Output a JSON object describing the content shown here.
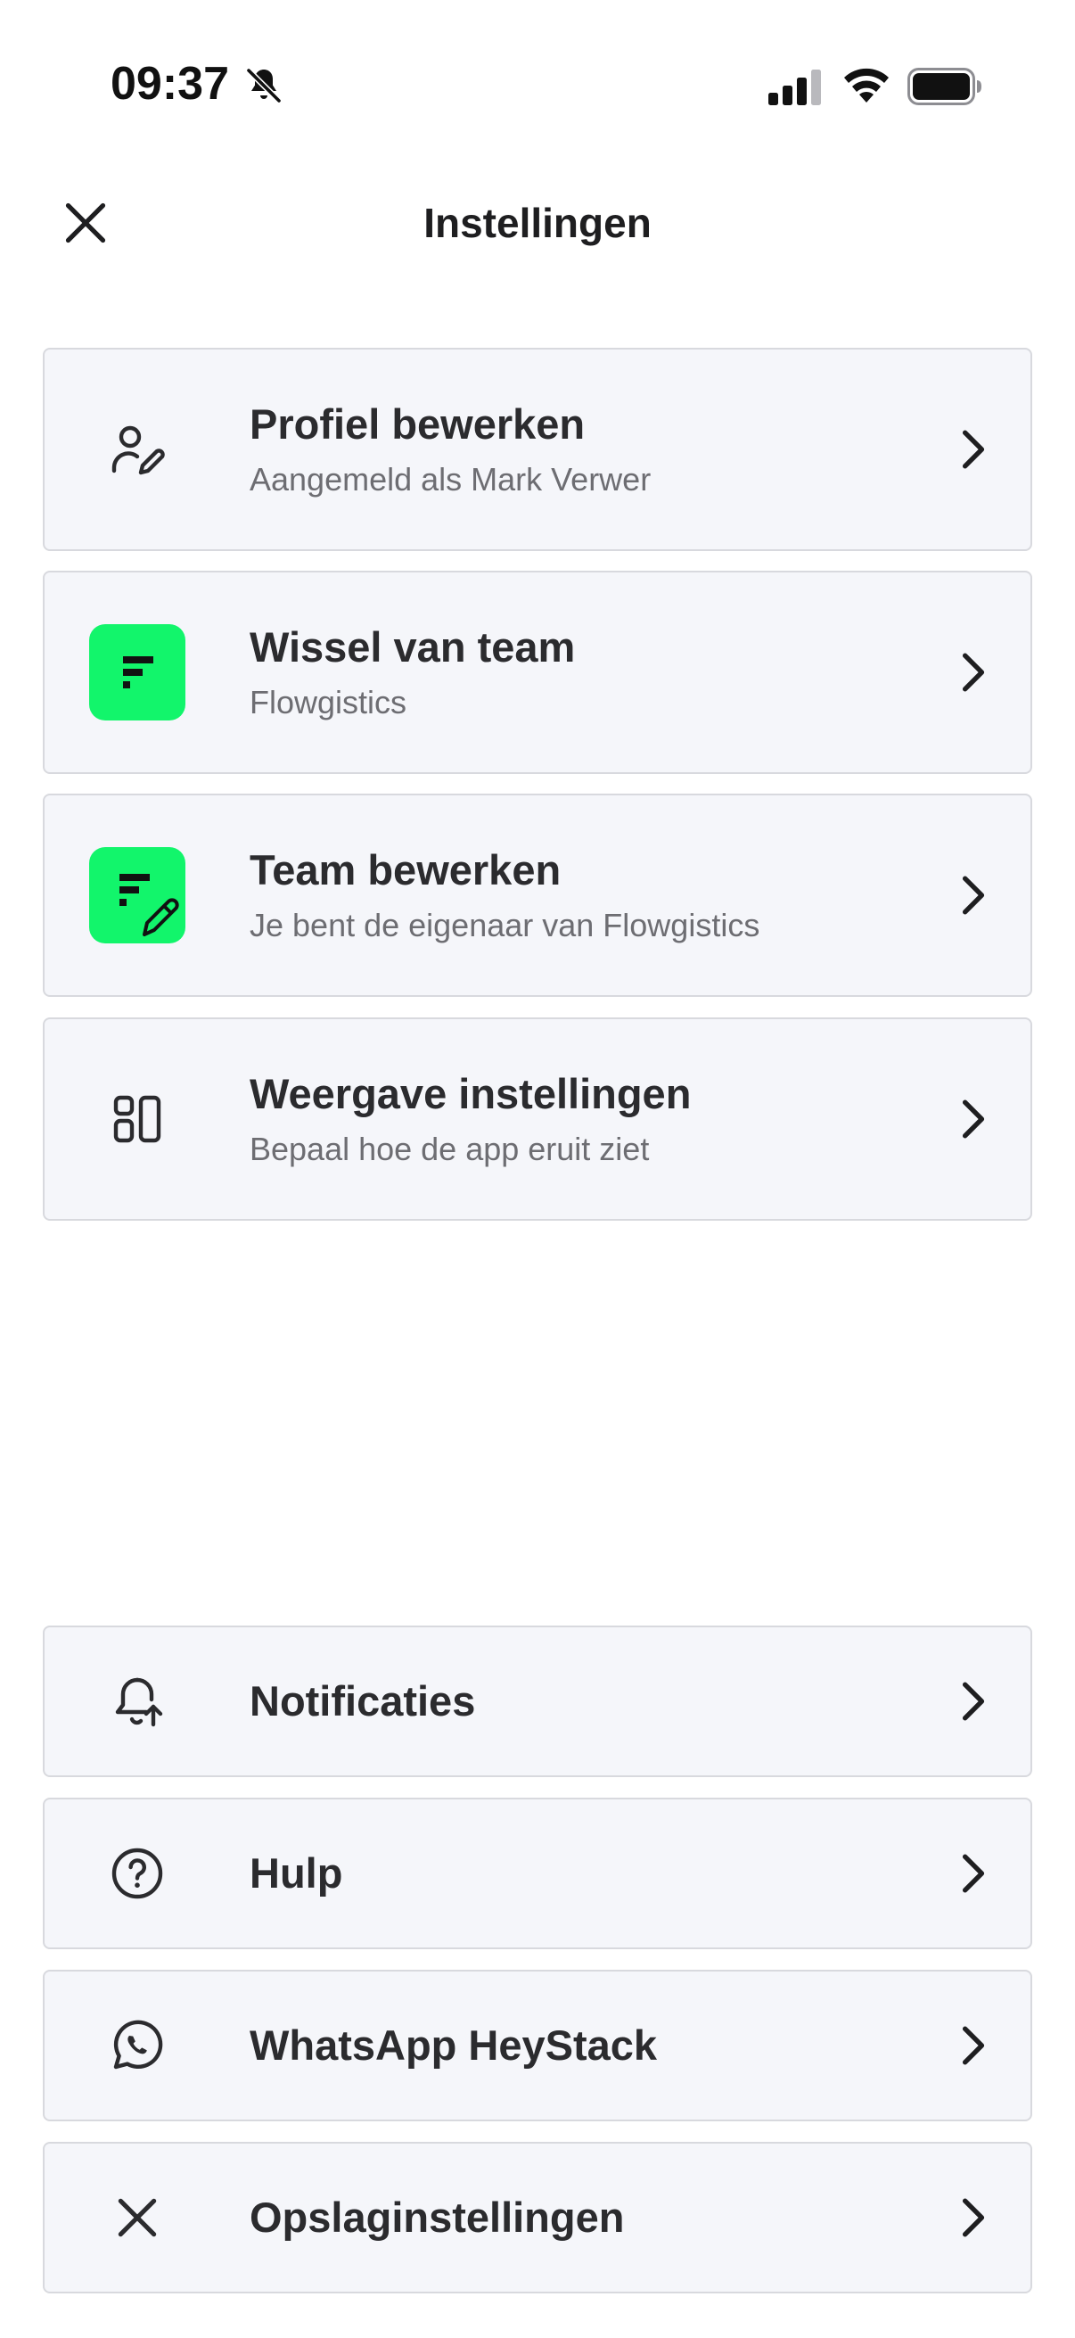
{
  "status_bar": {
    "time": "09:37",
    "icons": [
      "bell-slash-icon",
      "cellular-signal-icon",
      "wifi-icon",
      "battery-icon"
    ]
  },
  "header": {
    "title": "Instellingen",
    "close_icon": "close-icon"
  },
  "colors": {
    "brand_green": "#12f56b",
    "card_bg": "#f5f6fa",
    "card_border": "#d8d9de",
    "title_text": "#2b2b2e",
    "subtitle_text": "#6d6d72"
  },
  "top_items": [
    {
      "title": "Profiel bewerken",
      "subtitle": "Aangemeld als Mark Verwer",
      "icon": "user-edit-icon"
    },
    {
      "title": "Wissel van team",
      "subtitle": "Flowgistics",
      "icon": "team-logo-icon"
    },
    {
      "title": "Team bewerken",
      "subtitle": "Je bent de eigenaar van Flowgistics",
      "icon": "team-edit-icon"
    },
    {
      "title": "Weergave instellingen",
      "subtitle": "Bepaal hoe de app eruit ziet",
      "icon": "layout-icon"
    }
  ],
  "bottom_items": [
    {
      "title": "Notificaties",
      "icon": "bell-icon"
    },
    {
      "title": "Hulp",
      "icon": "help-icon"
    },
    {
      "title": "WhatsApp HeyStack",
      "icon": "whatsapp-icon"
    },
    {
      "title": "Opslaginstellingen",
      "icon": "close-icon"
    }
  ]
}
